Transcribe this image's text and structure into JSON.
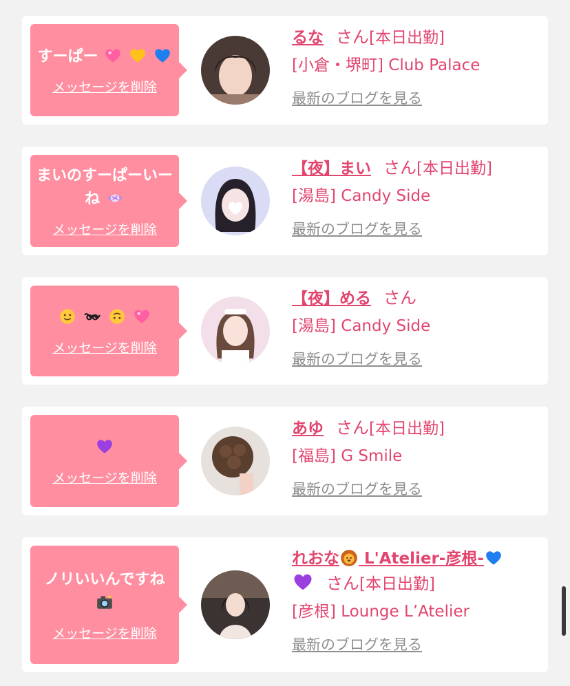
{
  "common": {
    "san": "さん",
    "delete_label": "メッセージを削除",
    "blog_label": "最新のブログを見る"
  },
  "entries": [
    {
      "message": "すーぱー",
      "message_emoji": [
        "pink-heart",
        "yellow-heart",
        "blue-heart"
      ],
      "name": "るな",
      "shift": "[本日出勤]",
      "store": "[小倉・堺町] Club Palace"
    },
    {
      "message": "まいのすーぱーいーね",
      "message_emoji": [
        "candy"
      ],
      "name": "【夜】まい",
      "shift": "[本日出勤]",
      "store": "[湯島] Candy Side"
    },
    {
      "message": "",
      "message_emoji": [
        "slightly-smiling-face",
        "double-curly-loop",
        "upside-down-face",
        "pink-heart"
      ],
      "name": "【夜】める",
      "shift": "",
      "store": "[湯島] Candy Side"
    },
    {
      "message": "",
      "message_emoji": [
        "purple-heart"
      ],
      "name": "あゆ",
      "shift": "[本日出勤]",
      "store": "[福島] G Smile"
    },
    {
      "message": "ノリいいんですね",
      "message_emoji": [
        "camera-with-flash"
      ],
      "name_part1": "れおな",
      "name_part2": " L'Atelier-彦根-",
      "name_emoji": [
        "lion-face",
        "blue-heart",
        "purple-heart"
      ],
      "shift": "[本日出勤]",
      "store": "[彦根] Lounge L’Atelier"
    }
  ],
  "colors": {
    "background": "#f2f2f2",
    "bubble": "#ff8fa0",
    "accent": "#e2456e",
    "link_gray": "#8e8e8e"
  }
}
